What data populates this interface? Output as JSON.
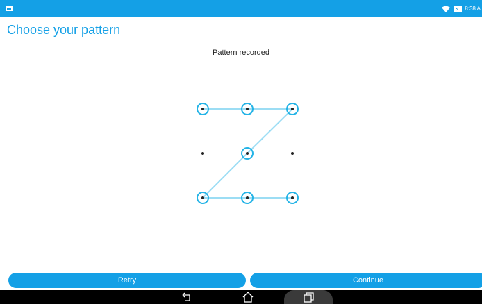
{
  "status_bar": {
    "time": "8:38 A",
    "left_icon": "notification-icon",
    "wifi_icon": "wifi-icon",
    "battery_icon": "battery-charging-icon",
    "color": "#14a0e6"
  },
  "header": {
    "title": "Choose your pattern"
  },
  "main": {
    "status_message": "Pattern recorded",
    "pattern": {
      "grid_size": 3,
      "selected_nodes": [
        1,
        2,
        3,
        5,
        7,
        8,
        9
      ],
      "sequence": [
        1,
        2,
        3,
        5,
        7,
        8,
        9
      ],
      "accent_color": "#23b3e6"
    }
  },
  "buttons": {
    "retry_label": "Retry",
    "continue_label": "Continue"
  },
  "nav_bar": {
    "back_icon": "back-icon",
    "home_icon": "home-icon",
    "recents_icon": "recents-icon"
  }
}
